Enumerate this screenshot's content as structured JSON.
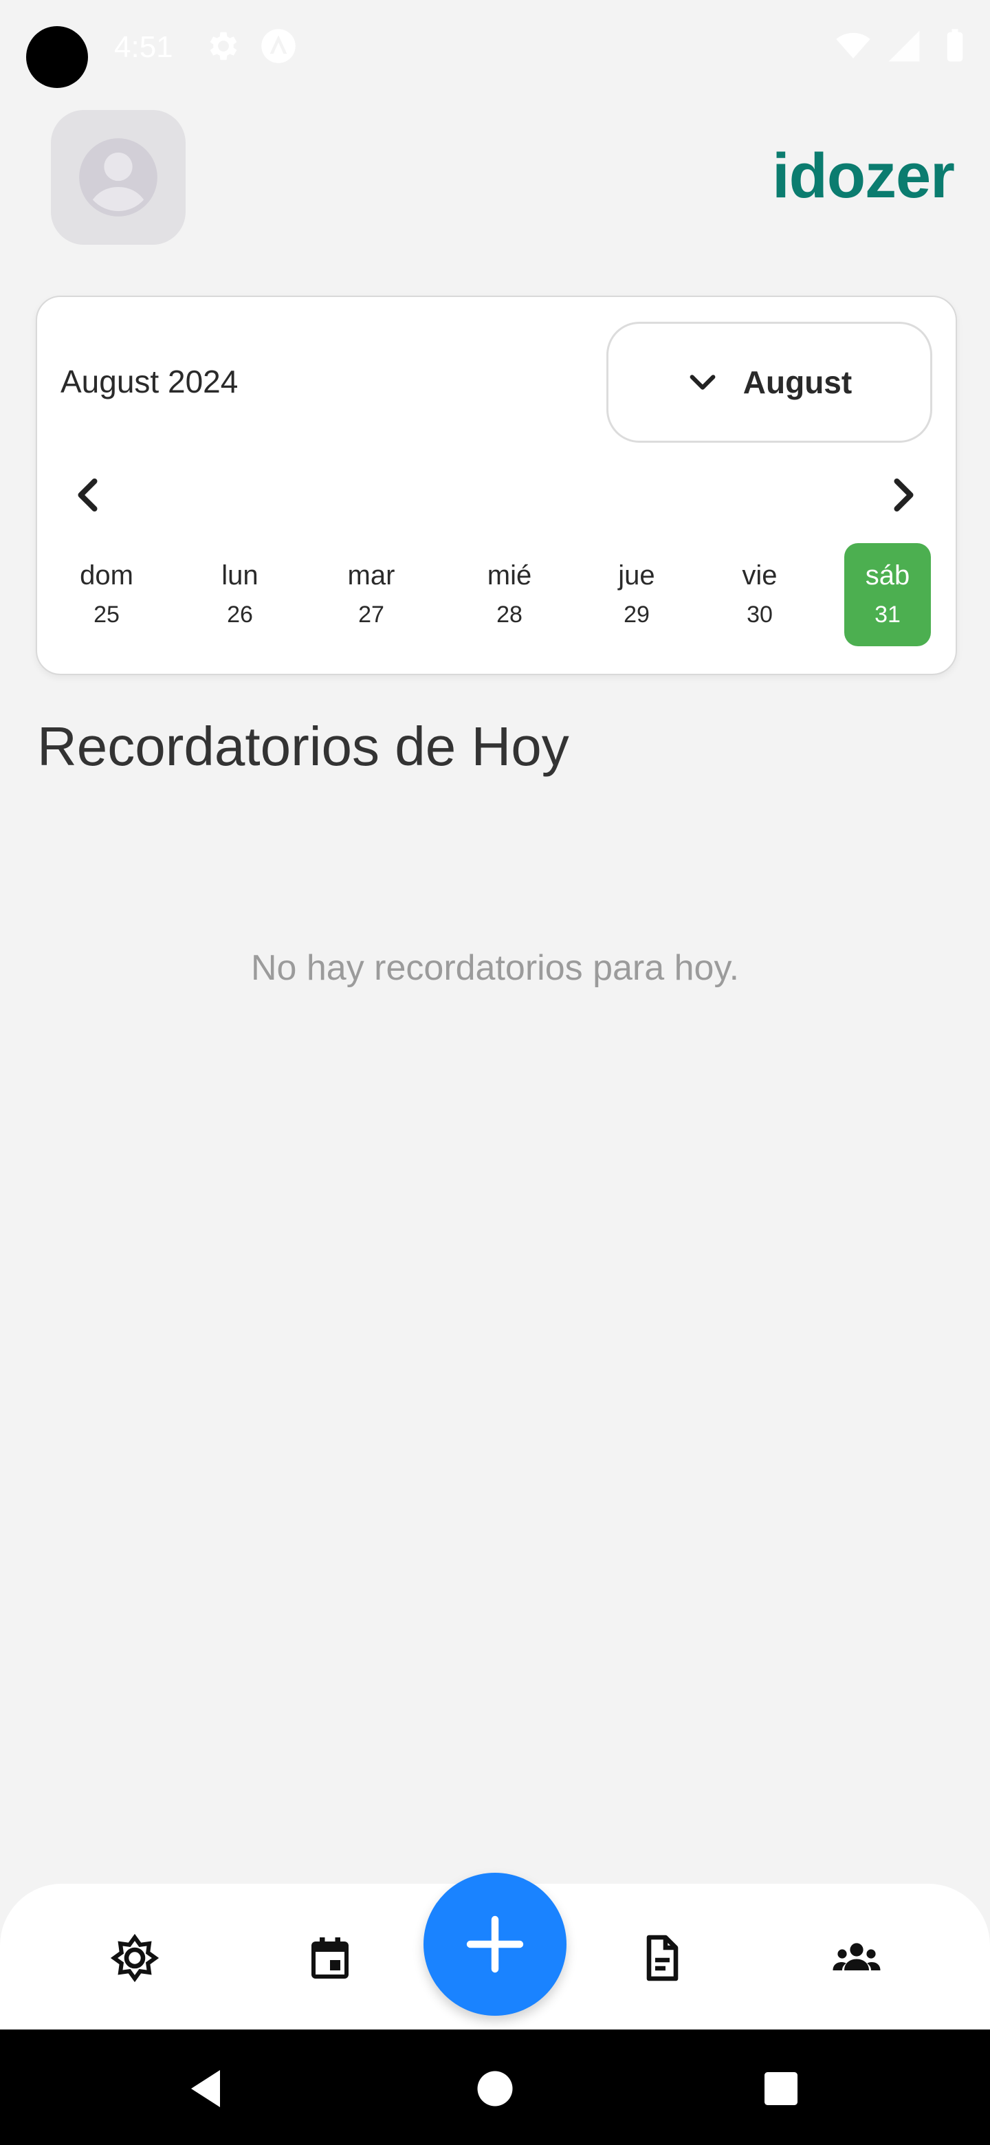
{
  "status_bar": {
    "time": "4:51",
    "icons_left": [
      "settings-icon",
      "app-notification-icon"
    ],
    "icons_right": [
      "wifi-icon",
      "signal-icon",
      "battery-icon"
    ]
  },
  "header": {
    "avatar_icon": "account-circle-icon",
    "brand": "idozer",
    "brand_color": "#0b7c6f"
  },
  "calendar": {
    "month_year": "August 2024",
    "month_select": "August",
    "days": [
      {
        "name": "dom",
        "num": "25",
        "selected": false
      },
      {
        "name": "lun",
        "num": "26",
        "selected": false
      },
      {
        "name": "mar",
        "num": "27",
        "selected": false
      },
      {
        "name": "mié",
        "num": "28",
        "selected": false
      },
      {
        "name": "jue",
        "num": "29",
        "selected": false
      },
      {
        "name": "vie",
        "num": "30",
        "selected": false
      },
      {
        "name": "sáb",
        "num": "31",
        "selected": true
      }
    ],
    "selected_color": "#4caf50"
  },
  "reminders": {
    "title": "Recordatorios de Hoy",
    "empty_message": "No hay recordatorios para hoy."
  },
  "bottom_nav": {
    "items": [
      "brightness-icon",
      "calendar-icon",
      "add-icon",
      "document-icon",
      "group-icon"
    ],
    "fab_color": "#1a83ff"
  },
  "system_nav": [
    "back-icon",
    "home-icon",
    "recents-icon"
  ]
}
